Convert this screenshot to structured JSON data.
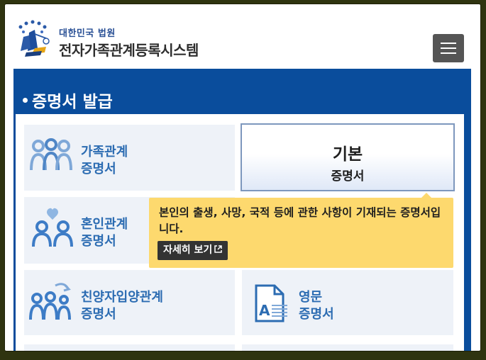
{
  "header": {
    "court_name": "대한민국 법원",
    "system_name": "전자가족관계등록시스템",
    "menu_icon": "hamburger-menu-icon"
  },
  "section": {
    "title": "증명서 발급"
  },
  "cards": [
    {
      "line1": "가족관계",
      "line2": "증명서",
      "icon": "family-icon"
    },
    {
      "line1": "기본",
      "line2": "증명서",
      "selected": true
    },
    {
      "line1": "혼인관계",
      "line2": "증명서",
      "icon": "couple-heart-icon"
    },
    {
      "line1": "친양자입양관계",
      "line2": "증명서",
      "icon": "adoption-icon"
    },
    {
      "line1": "영문",
      "line2": "증명서",
      "icon": "english-document-icon"
    }
  ],
  "tooltip": {
    "text": "본인의 출생, 사망, 국적 등에 관한 사항이 기재되는 증명서입니다.",
    "button_label": "자세히 보기"
  },
  "colors": {
    "panel_blue": "#0a4d9c",
    "card_text_blue": "#2c6cb2",
    "tooltip_yellow": "#fdd96e",
    "card_bg": "#eef2f8"
  }
}
